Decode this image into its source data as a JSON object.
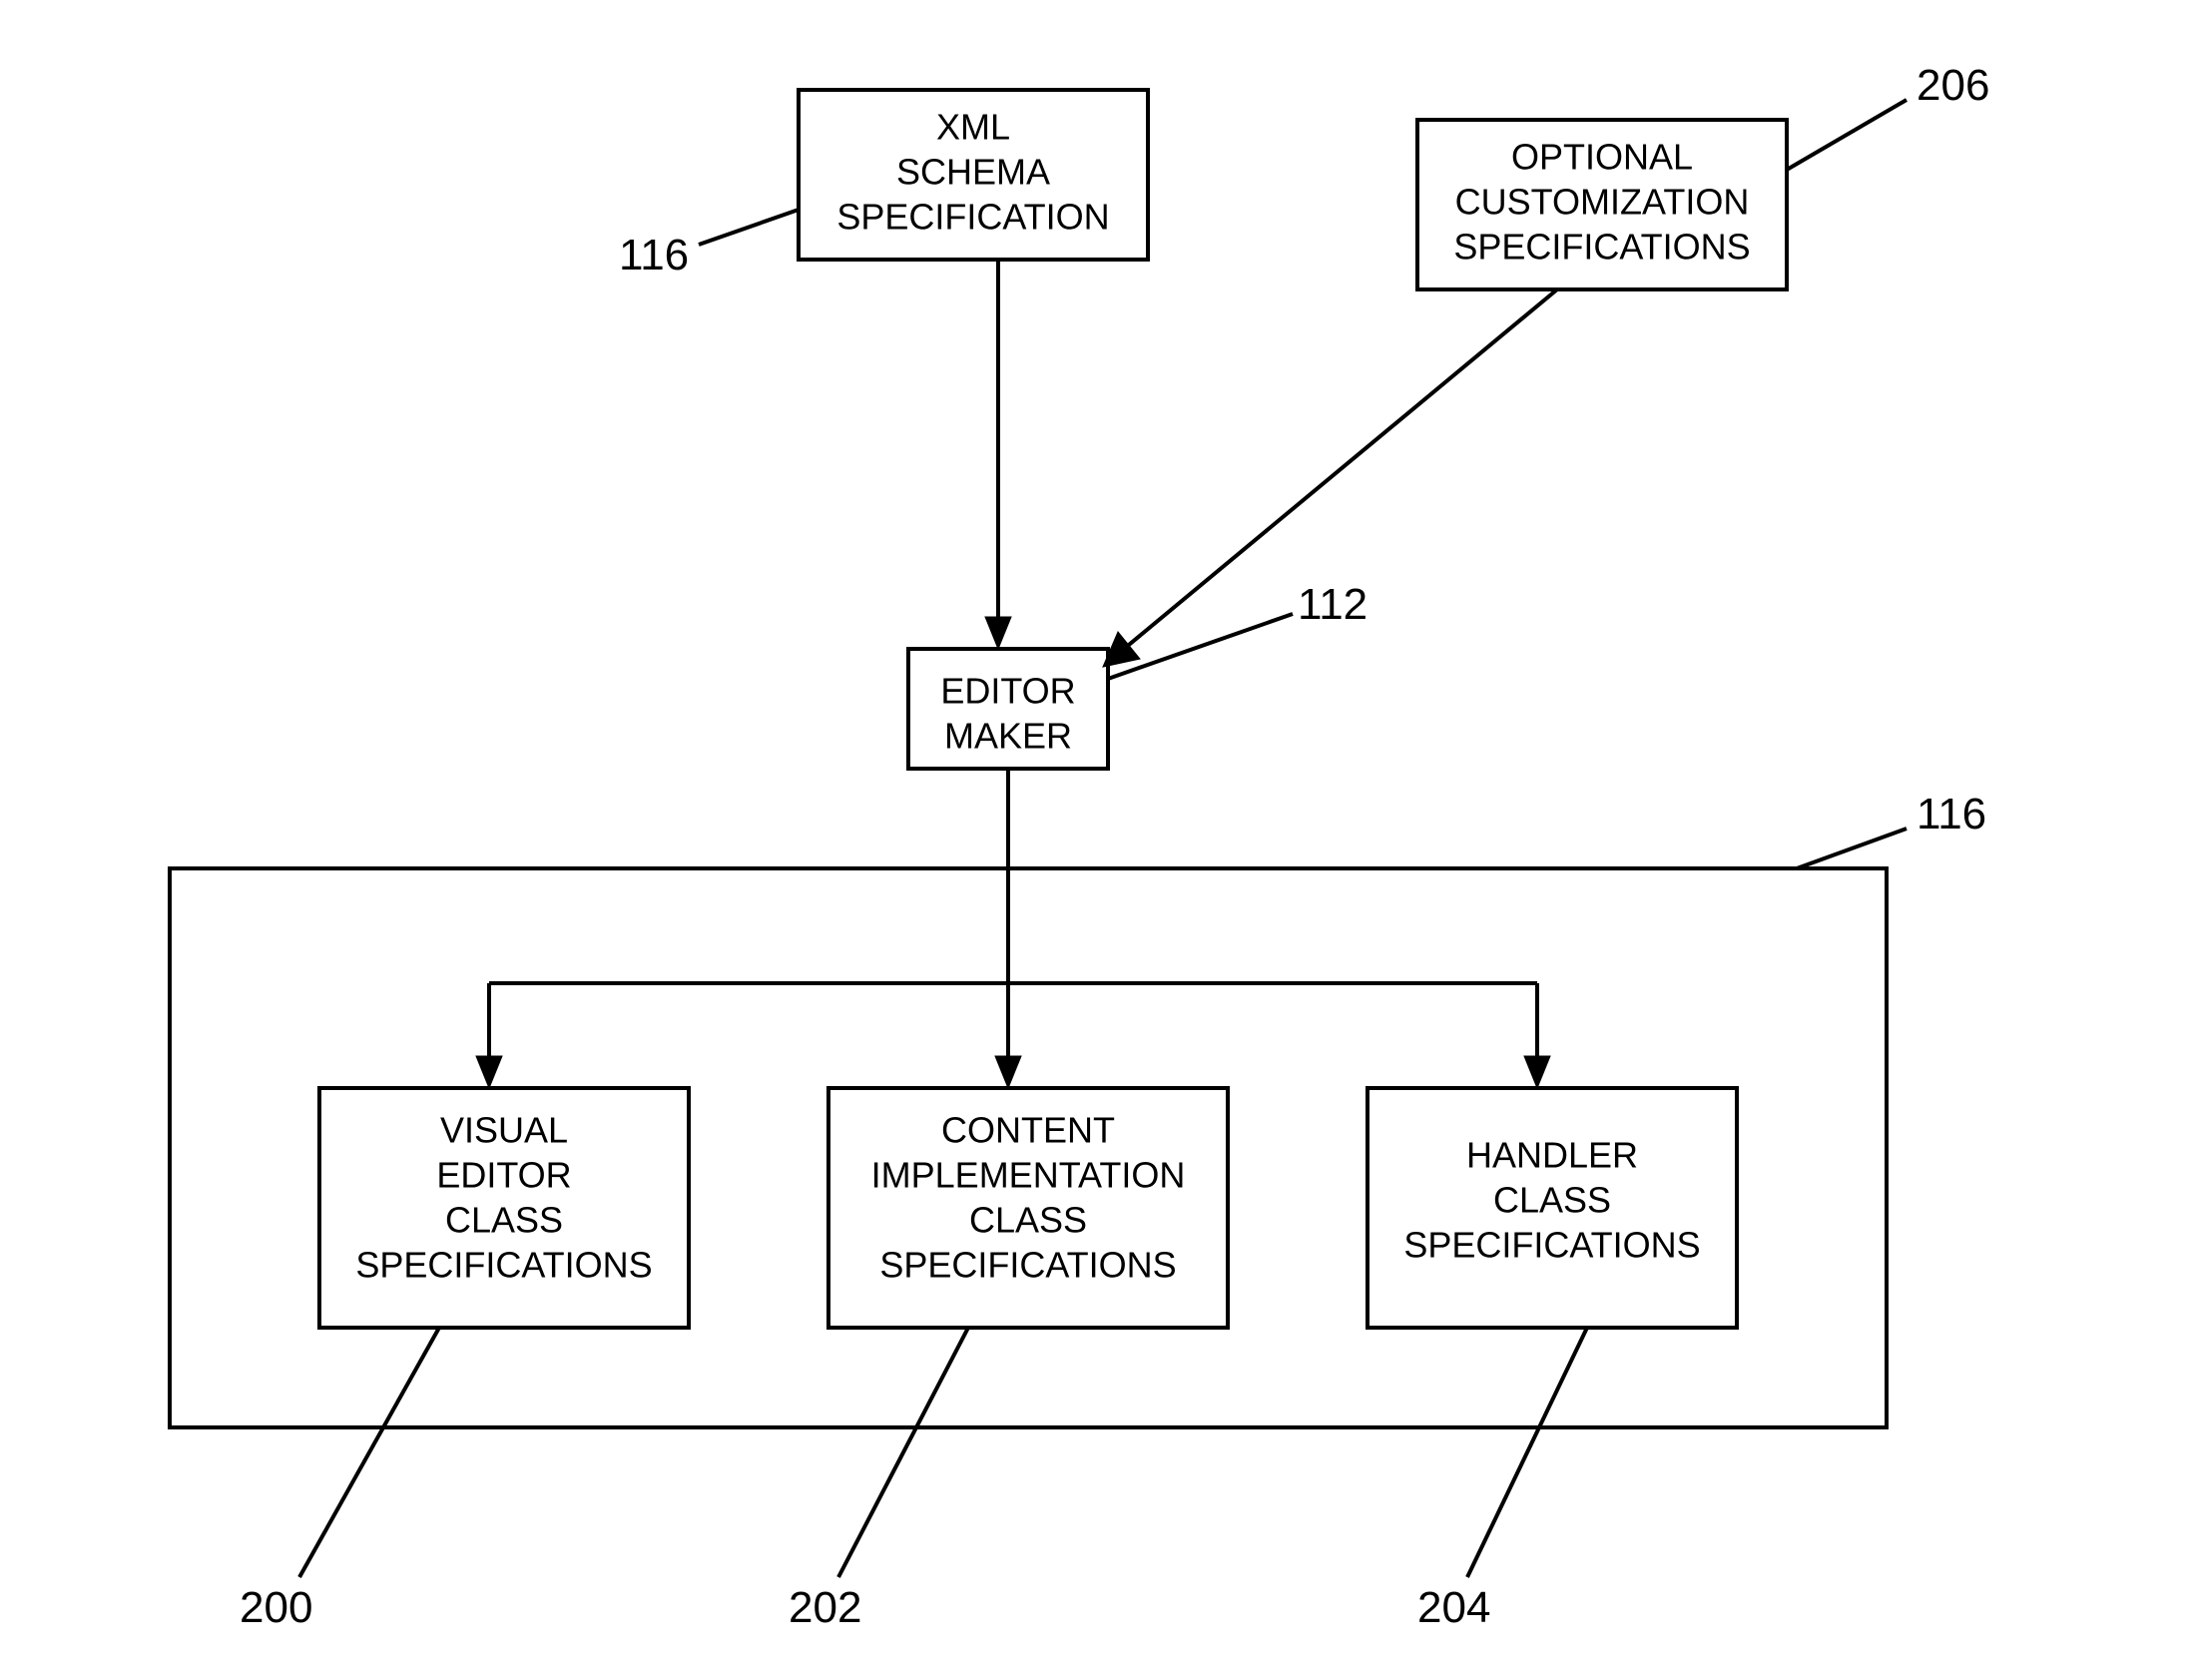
{
  "boxes": {
    "xml": {
      "l1": "XML",
      "l2": "SCHEMA",
      "l3": "SPECIFICATION"
    },
    "optional": {
      "l1": "OPTIONAL",
      "l2": "CUSTOMIZATION",
      "l3": "SPECIFICATIONS"
    },
    "editor": {
      "l1": "EDITOR",
      "l2": "MAKER"
    },
    "visual": {
      "l1": "VISUAL",
      "l2": "EDITOR",
      "l3": "CLASS",
      "l4": "SPECIFICATIONS"
    },
    "content": {
      "l1": "CONTENT",
      "l2": "IMPLEMENTATION",
      "l3": "CLASS",
      "l4": "SPECIFICATIONS"
    },
    "handler": {
      "l1": "HANDLER",
      "l2": "CLASS",
      "l3": "SPECIFICATIONS"
    }
  },
  "labels": {
    "n116a": "116",
    "n206": "206",
    "n112": "112",
    "n116b": "116",
    "n200": "200",
    "n202": "202",
    "n204": "204"
  }
}
